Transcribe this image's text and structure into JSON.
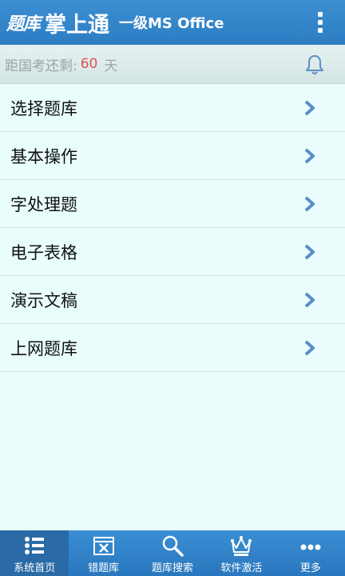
{
  "header": {
    "logo_script": "题库",
    "logo_main": "掌上通",
    "subtitle": "一级MS Office",
    "more_icon": "more-vertical-icon"
  },
  "countdown": {
    "label": "距国考还剩:",
    "days": "60",
    "unit": "天",
    "bell_icon": "bell-icon"
  },
  "menu": {
    "items": [
      {
        "label": "选择题库"
      },
      {
        "label": "基本操作"
      },
      {
        "label": "字处理题"
      },
      {
        "label": "电子表格"
      },
      {
        "label": "演示文稿"
      },
      {
        "label": "上网题库"
      }
    ],
    "chevron_icon": "chevron-right-icon"
  },
  "bottom_nav": {
    "items": [
      {
        "label": "系统首页",
        "icon": "list-icon",
        "active": true
      },
      {
        "label": "错题库",
        "icon": "wrong-answers-icon",
        "active": false
      },
      {
        "label": "题库搜索",
        "icon": "search-icon",
        "active": false
      },
      {
        "label": "软件激活",
        "icon": "crown-icon",
        "active": false
      },
      {
        "label": "更多",
        "icon": "more-dots-icon",
        "active": false
      }
    ]
  },
  "colors": {
    "header_blue": "#2c7dc3",
    "background": "#e9fdfd",
    "days_red": "#d9534f",
    "chevron_blue": "#5b8fc9"
  }
}
